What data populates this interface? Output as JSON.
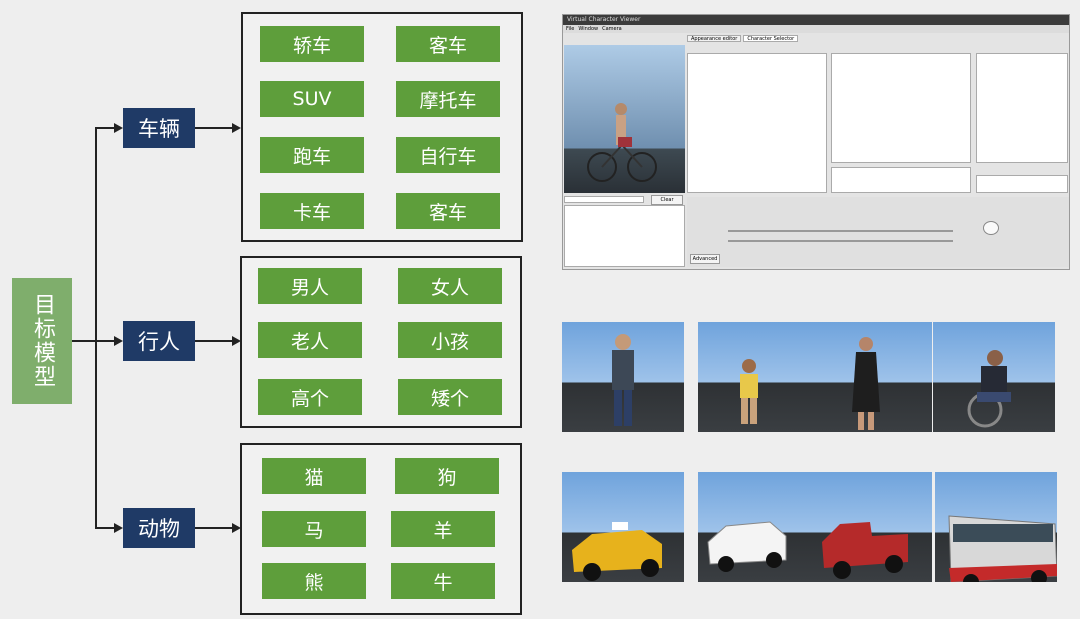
{
  "root": {
    "label": "目标模型"
  },
  "categories": [
    {
      "label": "车辆",
      "items": [
        "轿车",
        "客车",
        "SUV",
        "摩托车",
        "跑车",
        "自行车",
        "卡车",
        "客车"
      ]
    },
    {
      "label": "行人",
      "items": [
        "男人",
        "女人",
        "老人",
        "小孩",
        "高个",
        "矮个"
      ]
    },
    {
      "label": "动物",
      "items": [
        "猫",
        "狗",
        "马",
        "羊",
        "熊",
        "牛"
      ]
    }
  ],
  "colors": {
    "root": "#7fae6c",
    "category": "#1f3a66",
    "leaf": "#5e9e3b"
  },
  "viewer": {
    "title": "Virtual Character Viewer",
    "menu": [
      "File",
      "Window",
      "Camera"
    ],
    "tabs": [
      "Appearance editor",
      "Character Selector"
    ],
    "button": "Clear",
    "advanced": "Advanced"
  },
  "thumbnails": [
    "man-icon",
    "boy-icon",
    "woman-icon",
    "wheelchair-man-icon",
    "taxi-icon",
    "sedan-icon",
    "pickup-truck-icon",
    "bus-icon"
  ]
}
